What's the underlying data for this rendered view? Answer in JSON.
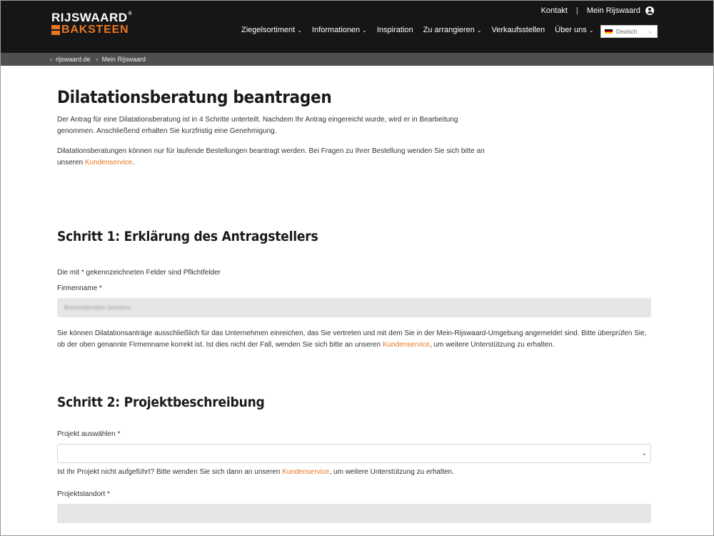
{
  "brand": {
    "logo_top": "RIJSWAARD",
    "logo_reg": "®",
    "logo_bottom": "BAKSTEEN",
    "accent": "#e87722",
    "header_bg": "#161616"
  },
  "top_links": {
    "contact": "Kontakt",
    "separator": "|",
    "account": "Mein Rijswaard",
    "account_icon": "user-circle-icon"
  },
  "nav": {
    "items": [
      {
        "label": "Ziegelsortiment",
        "dropdown": true
      },
      {
        "label": "Informationen",
        "dropdown": true
      },
      {
        "label": "Inspiration",
        "dropdown": false
      },
      {
        "label": "Zu arrangieren",
        "dropdown": true
      },
      {
        "label": "Verkaufsstellen",
        "dropdown": false
      },
      {
        "label": "Über uns",
        "dropdown": true
      }
    ],
    "caret": "⌄"
  },
  "language": {
    "selected": "Deutsch",
    "caret": "⌄"
  },
  "breadcrumb": {
    "arrow": "‹",
    "items": [
      "rijswaard.de",
      "Mein Rijswaard"
    ]
  },
  "page": {
    "title": "Dilatationsberatung beantragen",
    "intro1": "Der Antrag für eine Dilatationsberatung ist in 4 Schritte unterteilt. Nachdem Ihr Antrag eingereicht wurde, wird er in Bearbeitung genommen. Anschließend erhalten Sie kurzfristig eine Genehmigung.",
    "intro2_pre": "Dilatationsberatungen können nur für laufende Bestellungen beantragt werden. Bei Fragen zu Ihrer Bestellung wenden Sie sich bitte an unseren ",
    "intro2_link": "Kundenservice",
    "intro2_post": "."
  },
  "step1": {
    "heading": "Schritt 1: Erklärung des Antragstellers",
    "required_note": "Die mit * gekennzeichneten Felder sind Pflichtfelder",
    "company_label": "Firmenname *",
    "company_value": "Bouwmaterialen Janssens",
    "info_pre": "Sie können Dilatationsanträge ausschließlich für das Unternehmen einreichen, das Sie vertreten und mit dem Sie in der Mein-Rijswaard-Umgebung angemeldet sind. Bitte überprüfen Sie, ob der oben genannte Firmenname korrekt ist. Ist dies nicht der Fall, wenden Sie sich bitte an unseren ",
    "info_link": "Kundenservice",
    "info_post": ", um weitere Unterstützung zu erhalten."
  },
  "step2": {
    "heading": "Schritt 2: Projektbeschreibung",
    "project_label": "Projekt auswählen *",
    "project_value": "",
    "project_caret": "⌄",
    "missing_pre": "Ist Ihr Projekt nicht aufgeführt? Bitte wenden Sie sich dann an unseren ",
    "missing_link": "Kundenservice",
    "missing_post": ", um weitere Unterstützung zu erhalten.",
    "location_label": "Projektstandort *",
    "location_value": ""
  }
}
